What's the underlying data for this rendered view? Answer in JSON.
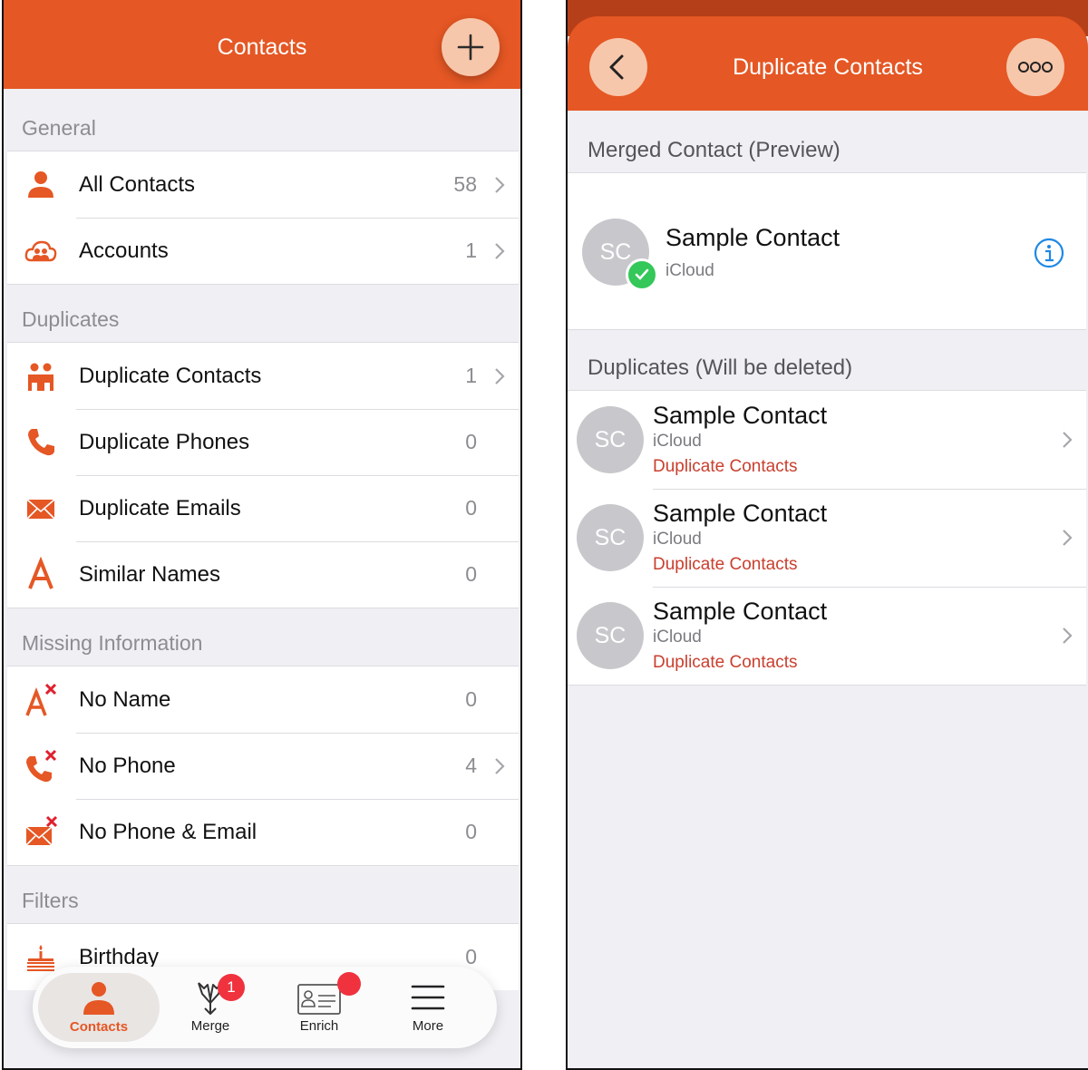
{
  "left": {
    "nav_title": "Contacts",
    "sections": [
      {
        "header": "General",
        "items": [
          {
            "label": "All Contacts",
            "count": "58",
            "icon": "person-icon",
            "chevron": true
          },
          {
            "label": "Accounts",
            "count": "1",
            "icon": "cloud-people-icon",
            "chevron": true
          }
        ]
      },
      {
        "header": "Duplicates",
        "items": [
          {
            "label": "Duplicate Contacts",
            "count": "1",
            "icon": "people-icon",
            "chevron": true
          },
          {
            "label": "Duplicate Phones",
            "count": "0",
            "icon": "phone-icon",
            "chevron": false
          },
          {
            "label": "Duplicate Emails",
            "count": "0",
            "icon": "envelope-icon",
            "chevron": false
          },
          {
            "label": "Similar Names",
            "count": "0",
            "icon": "letter-a-icon",
            "chevron": false
          }
        ]
      },
      {
        "header": "Missing Information",
        "items": [
          {
            "label": "No Name",
            "count": "0",
            "icon": "letter-a-x-icon",
            "chevron": false
          },
          {
            "label": "No Phone",
            "count": "4",
            "icon": "phone-x-icon",
            "chevron": true
          },
          {
            "label": "No Phone & Email",
            "count": "0",
            "icon": "envelope-x-icon",
            "chevron": false
          }
        ]
      },
      {
        "header": "Filters",
        "items": [
          {
            "label": "Birthday",
            "count": "0",
            "icon": "cake-icon",
            "chevron": false
          }
        ]
      }
    ],
    "tabbar": {
      "tabs": [
        {
          "label": "Contacts",
          "icon": "person-icon",
          "active": true
        },
        {
          "label": "Merge",
          "icon": "merge-icon",
          "badge": "1"
        },
        {
          "label": "Enrich",
          "icon": "id-card-icon",
          "badge_dot": true
        },
        {
          "label": "More",
          "icon": "hamburger-icon"
        }
      ]
    }
  },
  "right": {
    "nav_title": "Duplicate Contacts",
    "merged_header": "Merged Contact (Preview)",
    "merged": {
      "initials": "SC",
      "name": "Sample Contact",
      "account": "iCloud"
    },
    "duplicates_header": "Duplicates (Will be deleted)",
    "duplicates": [
      {
        "initials": "SC",
        "name": "Sample Contact",
        "account": "iCloud",
        "tag": "Duplicate Contacts"
      },
      {
        "initials": "SC",
        "name": "Sample Contact",
        "account": "iCloud",
        "tag": "Duplicate Contacts"
      },
      {
        "initials": "SC",
        "name": "Sample Contact",
        "account": "iCloud",
        "tag": "Duplicate Contacts"
      }
    ]
  },
  "colors": {
    "accent": "#e55724",
    "accent_light": "#f7c7ab",
    "badge": "#f0323f",
    "check": "#34c759",
    "info": "#1e88e5",
    "tag_red": "#c93f2e"
  }
}
